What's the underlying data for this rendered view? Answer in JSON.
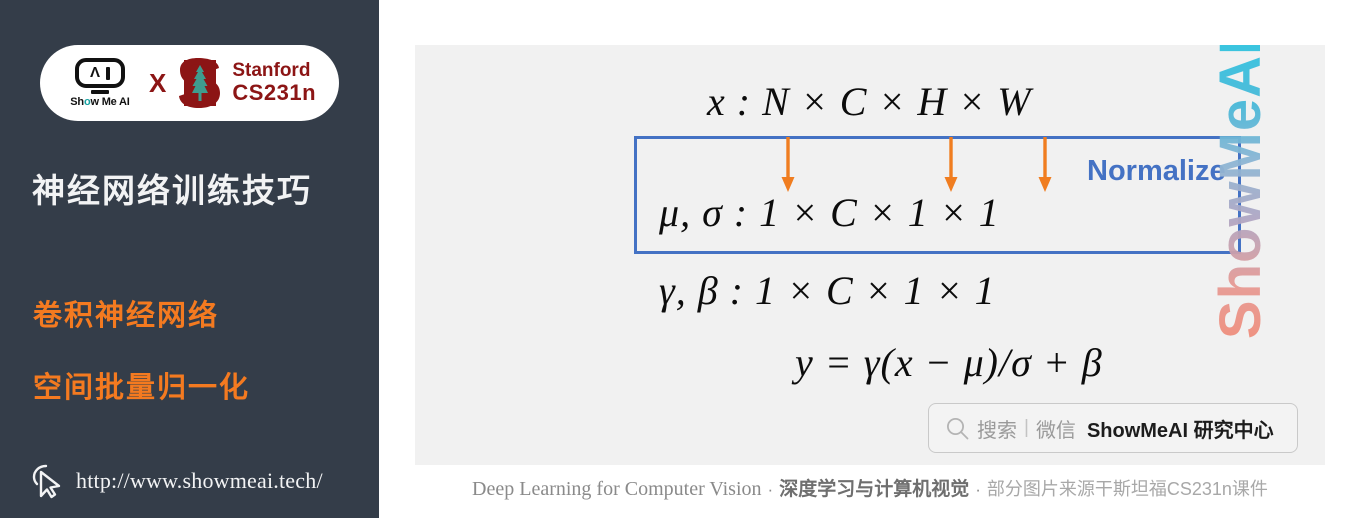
{
  "sidebar": {
    "logo": {
      "showmeai_word": "Show Me AI",
      "showmeai_head_glyph": "Λ",
      "cross_label": "X",
      "stanford_line1": "Stanford",
      "stanford_line2": "CS231n"
    },
    "course_title": "神经网络训练技巧",
    "topic_title": "卷积神经网络",
    "subtopic_title": "空间批量归一化",
    "site_url": "http://www.showmeai.tech/",
    "background_color": "#343d49",
    "accent_color": "#f47a20"
  },
  "slide": {
    "formulas": {
      "input_shape": "x : N × C × H × W",
      "stats_shape": "μ, σ : 1 × C × 1 × 1",
      "params_shape": "γ, β : 1 × C × 1 × 1",
      "output": "y = γ(x − μ)/σ + β"
    },
    "normalize_label": "Normalize",
    "box_border_color": "#4472c4",
    "arrow_color": "#f07d20",
    "arrow_count": 3,
    "arrow_targets": [
      "N",
      "H",
      "W"
    ],
    "watermark_vertical": "ShowMeAI",
    "wechat": {
      "search_label": "搜索",
      "separator": "|",
      "platform": "微信",
      "brand": "ShowMeAI 研究中心"
    }
  },
  "footer": {
    "english": "Deep Learning for Computer Vision",
    "dot1": "·",
    "chinese_bold": "深度学习与计算机视觉",
    "dot2": "·",
    "chinese_light": "部分图片来源干斯坦福CS231n课件"
  }
}
